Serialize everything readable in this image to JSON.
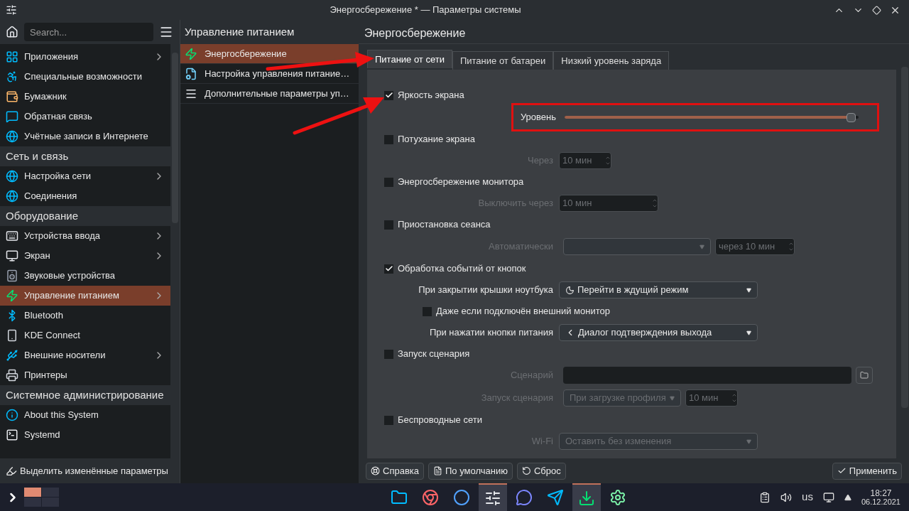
{
  "window": {
    "title": "Энергосбережение * — Параметры системы"
  },
  "sidebar": {
    "search": {
      "placeholder": "Search..."
    },
    "groups": [
      {
        "items": [
          {
            "label": "Приложения",
            "has_children": true,
            "selected": false
          },
          {
            "label": "Специальные возможности",
            "has_children": false,
            "selected": false
          },
          {
            "label": "Бумажник",
            "has_children": false,
            "selected": false
          },
          {
            "label": "Обратная связь",
            "has_children": false,
            "selected": false
          },
          {
            "label": "Учётные записи в Интернете",
            "has_children": false,
            "selected": false
          }
        ]
      },
      {
        "title": "Сеть и связь",
        "items": [
          {
            "label": "Настройка сети",
            "has_children": true,
            "selected": false
          },
          {
            "label": "Соединения",
            "has_children": false,
            "selected": false
          }
        ]
      },
      {
        "title": "Оборудование",
        "items": [
          {
            "label": "Устройства ввода",
            "has_children": true,
            "selected": false
          },
          {
            "label": "Экран",
            "has_children": true,
            "selected": false
          },
          {
            "label": "Звуковые устройства",
            "has_children": false,
            "selected": false
          },
          {
            "label": "Управление питанием",
            "has_children": true,
            "selected": true
          },
          {
            "label": "Bluetooth",
            "has_children": false,
            "selected": false
          },
          {
            "label": "KDE Connect",
            "has_children": false,
            "selected": false
          },
          {
            "label": "Внешние носители",
            "has_children": true,
            "selected": false
          },
          {
            "label": "Принтеры",
            "has_children": false,
            "selected": false
          }
        ]
      },
      {
        "title": "Системное администрирование",
        "items": [
          {
            "label": "About this System",
            "has_children": false,
            "selected": false
          },
          {
            "label": "Systemd",
            "has_children": false,
            "selected": false
          }
        ]
      }
    ],
    "footer_button": "Выделить изменённые параметры"
  },
  "subpane": {
    "title": "Управление питанием",
    "items": [
      {
        "label": "Энергосбережение",
        "selected": true
      },
      {
        "label": "Настройка управления питание…",
        "selected": false
      },
      {
        "label": "Дополнительные параметры уп…",
        "selected": false
      }
    ]
  },
  "content": {
    "title": "Энергосбережение",
    "tabs": [
      {
        "label": "Питание от сети",
        "selected": true
      },
      {
        "label": "Питание от батареи",
        "selected": false
      },
      {
        "label": "Низкий уровень заряда",
        "selected": false
      }
    ],
    "rows": [
      {
        "kind": "checkbox",
        "label": "Яркость экрана",
        "checked": true
      },
      {
        "kind": "slider",
        "label": "Уровень",
        "level": 0.99,
        "annotated": true
      },
      {
        "kind": "checkbox",
        "label": "Потухание экрана",
        "checked": false
      },
      {
        "kind": "spin",
        "label": "Через",
        "value": "10 мин",
        "disabled": true
      },
      {
        "kind": "checkbox",
        "label": "Энергосбережение монитора",
        "checked": false
      },
      {
        "kind": "spin",
        "label": "Выключить через",
        "value": "10 мин",
        "disabled": true
      },
      {
        "kind": "checkbox",
        "label": "Приостановка сеанса",
        "checked": false
      },
      {
        "kind": "combo_spin",
        "label": "Автоматически",
        "spin_value": "через 10 мин",
        "disabled": true
      },
      {
        "kind": "checkbox",
        "label": "Обработка событий от кнопок",
        "checked": true
      },
      {
        "kind": "combo",
        "label": "При закрытии крышки ноутбука",
        "value": "Перейти в ждущий режим",
        "disabled": false
      },
      {
        "kind": "sub_checkbox",
        "label": "Даже если подключён внешний монитор",
        "checked": false
      },
      {
        "kind": "combo",
        "label": "При нажатии кнопки питания",
        "value": "Диалог подтверждения выхода",
        "disabled": false
      },
      {
        "kind": "checkbox",
        "label": "Запуск сценария",
        "checked": false
      },
      {
        "kind": "file",
        "label": "Сценарий",
        "disabled": true
      },
      {
        "kind": "combo_spin",
        "label": "Запуск сценария",
        "value": "При загрузке профиля",
        "spin_value": "10 мин",
        "disabled": true
      },
      {
        "kind": "checkbox",
        "label": "Беспроводные сети",
        "checked": false
      },
      {
        "kind": "combo",
        "label": "Wi-Fi",
        "value": "Оставить без изменения",
        "disabled": true
      }
    ]
  },
  "buttons": [
    {
      "label": "Справка"
    },
    {
      "label": "По умолчанию"
    },
    {
      "label": "Сброс"
    },
    {
      "label": "Применить"
    }
  ],
  "taskbar": {
    "desktops": [
      {
        "selected": true
      },
      {
        "selected": false
      },
      {
        "selected": false
      },
      {
        "selected": false
      }
    ],
    "apps": [
      {
        "active": false
      },
      {
        "active": false
      },
      {
        "active": false
      },
      {
        "active": true
      },
      {
        "active": false
      },
      {
        "active": false
      },
      {
        "active": true
      },
      {
        "active": false
      }
    ],
    "keyboard_layout": "us",
    "time": "18:27",
    "date": "06.12.2021"
  }
}
